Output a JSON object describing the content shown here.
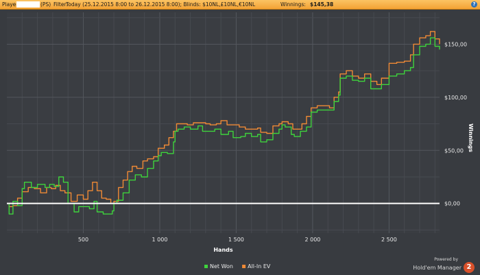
{
  "header": {
    "player_label": "Player:",
    "player_suffix": "(PS)",
    "filter_label": "Filter:",
    "filter_text": "Today (25.12.2015 8:00 to 26.12.2015 8:00); Blinds: $10NL,£10NL,€10NL",
    "winnings_label": "Winnings:",
    "winnings_value": "$145,38",
    "help_icon": "?"
  },
  "branding": {
    "powered_by": "Powered by",
    "product": "Hold'em Manager",
    "badge": "2"
  },
  "colors": {
    "background": "#383b40",
    "header": "#f4a63a",
    "net_won": "#3ed33c",
    "allin_ev": "#f08a35",
    "zero_line": "#ffffff",
    "grid": "#53575d"
  },
  "chart_data": {
    "type": "line",
    "xlabel": "Hands",
    "ylabel": "Winnings",
    "xlim": [
      0,
      2830
    ],
    "ylim": [
      -28,
      180
    ],
    "x_ticks": [
      500,
      1000,
      1500,
      2000,
      2500
    ],
    "x_tick_labels": [
      "500",
      "1 000",
      "1 500",
      "2 000",
      "2 500"
    ],
    "y_ticks": [
      0,
      50,
      100,
      150
    ],
    "y_tick_labels": [
      "$0,00",
      "$50,00",
      "$100,00",
      "$150,00"
    ],
    "y_axis_position": "right",
    "grid": true,
    "legend_position": "bottom-center",
    "series": [
      {
        "name": "Net Won",
        "color": "#3ed33c",
        "points": [
          [
            0,
            0
          ],
          [
            15,
            -10
          ],
          [
            40,
            2
          ],
          [
            70,
            -2
          ],
          [
            100,
            14
          ],
          [
            115,
            20
          ],
          [
            160,
            15
          ],
          [
            200,
            18
          ],
          [
            250,
            15
          ],
          [
            280,
            18
          ],
          [
            310,
            16
          ],
          [
            340,
            25
          ],
          [
            370,
            20
          ],
          [
            400,
            0
          ],
          [
            440,
            -8
          ],
          [
            470,
            -3
          ],
          [
            500,
            -3
          ],
          [
            540,
            -5
          ],
          [
            570,
            2
          ],
          [
            590,
            -8
          ],
          [
            630,
            -10
          ],
          [
            660,
            -10
          ],
          [
            690,
            -7
          ],
          [
            700,
            0
          ],
          [
            720,
            3
          ],
          [
            760,
            10
          ],
          [
            800,
            22
          ],
          [
            840,
            27
          ],
          [
            880,
            25
          ],
          [
            920,
            33
          ],
          [
            960,
            40
          ],
          [
            990,
            45
          ],
          [
            1010,
            48
          ],
          [
            1050,
            47
          ],
          [
            1090,
            58
          ],
          [
            1100,
            68
          ],
          [
            1120,
            70
          ],
          [
            1160,
            72
          ],
          [
            1200,
            70
          ],
          [
            1250,
            73
          ],
          [
            1280,
            68
          ],
          [
            1320,
            68
          ],
          [
            1360,
            70
          ],
          [
            1400,
            65
          ],
          [
            1450,
            68
          ],
          [
            1480,
            62
          ],
          [
            1530,
            63
          ],
          [
            1560,
            66
          ],
          [
            1600,
            63
          ],
          [
            1640,
            65
          ],
          [
            1660,
            58
          ],
          [
            1700,
            60
          ],
          [
            1740,
            66
          ],
          [
            1780,
            70
          ],
          [
            1800,
            74
          ],
          [
            1820,
            72
          ],
          [
            1860,
            65
          ],
          [
            1880,
            63
          ],
          [
            1920,
            68
          ],
          [
            1960,
            72
          ],
          [
            1990,
            86
          ],
          [
            2030,
            88
          ],
          [
            2060,
            88
          ],
          [
            2100,
            88
          ],
          [
            2140,
            96
          ],
          [
            2170,
            102
          ],
          [
            2180,
            118
          ],
          [
            2220,
            120
          ],
          [
            2260,
            116
          ],
          [
            2300,
            115
          ],
          [
            2340,
            118
          ],
          [
            2380,
            108
          ],
          [
            2420,
            108
          ],
          [
            2450,
            112
          ],
          [
            2480,
            112
          ],
          [
            2500,
            120
          ],
          [
            2550,
            122
          ],
          [
            2600,
            125
          ],
          [
            2640,
            128
          ],
          [
            2660,
            140
          ],
          [
            2700,
            148
          ],
          [
            2740,
            150
          ],
          [
            2770,
            156
          ],
          [
            2800,
            148
          ],
          [
            2830,
            145
          ]
        ]
      },
      {
        "name": "All-In EV",
        "color": "#f08a35",
        "points": [
          [
            0,
            0
          ],
          [
            15,
            -3
          ],
          [
            40,
            -2
          ],
          [
            70,
            5
          ],
          [
            100,
            11
          ],
          [
            140,
            15
          ],
          [
            180,
            14
          ],
          [
            220,
            10
          ],
          [
            260,
            15
          ],
          [
            290,
            14
          ],
          [
            320,
            17
          ],
          [
            350,
            12
          ],
          [
            380,
            10
          ],
          [
            420,
            2
          ],
          [
            460,
            8
          ],
          [
            500,
            4
          ],
          [
            530,
            12
          ],
          [
            560,
            20
          ],
          [
            590,
            12
          ],
          [
            620,
            5
          ],
          [
            650,
            4
          ],
          [
            680,
            0
          ],
          [
            700,
            2
          ],
          [
            730,
            15
          ],
          [
            760,
            22
          ],
          [
            790,
            30
          ],
          [
            820,
            35
          ],
          [
            850,
            33
          ],
          [
            890,
            40
          ],
          [
            920,
            42
          ],
          [
            960,
            44
          ],
          [
            990,
            52
          ],
          [
            1030,
            55
          ],
          [
            1060,
            62
          ],
          [
            1090,
            68
          ],
          [
            1110,
            75
          ],
          [
            1140,
            75
          ],
          [
            1180,
            74
          ],
          [
            1220,
            76
          ],
          [
            1270,
            76
          ],
          [
            1300,
            75
          ],
          [
            1330,
            74
          ],
          [
            1370,
            75
          ],
          [
            1400,
            78
          ],
          [
            1440,
            74
          ],
          [
            1490,
            74
          ],
          [
            1520,
            72
          ],
          [
            1560,
            70
          ],
          [
            1600,
            70
          ],
          [
            1640,
            71
          ],
          [
            1660,
            67
          ],
          [
            1700,
            66
          ],
          [
            1740,
            73
          ],
          [
            1780,
            75
          ],
          [
            1800,
            77
          ],
          [
            1840,
            75
          ],
          [
            1870,
            70
          ],
          [
            1900,
            70
          ],
          [
            1930,
            75
          ],
          [
            1960,
            82
          ],
          [
            1990,
            90
          ],
          [
            2030,
            92
          ],
          [
            2070,
            92
          ],
          [
            2110,
            90
          ],
          [
            2140,
            100
          ],
          [
            2170,
            105
          ],
          [
            2180,
            122
          ],
          [
            2220,
            125
          ],
          [
            2260,
            120
          ],
          [
            2300,
            118
          ],
          [
            2340,
            122
          ],
          [
            2380,
            115
          ],
          [
            2420,
            112
          ],
          [
            2450,
            118
          ],
          [
            2480,
            118
          ],
          [
            2500,
            132
          ],
          [
            2550,
            133
          ],
          [
            2600,
            134
          ],
          [
            2640,
            140
          ],
          [
            2660,
            150
          ],
          [
            2700,
            156
          ],
          [
            2740,
            158
          ],
          [
            2770,
            162
          ],
          [
            2800,
            155
          ],
          [
            2830,
            150
          ]
        ]
      }
    ]
  }
}
